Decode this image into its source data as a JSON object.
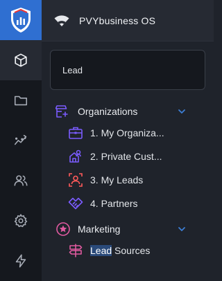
{
  "app": {
    "title": "PVYbusiness OS"
  },
  "search": {
    "value": "Lead",
    "placeholder": ""
  },
  "rail": {
    "items": [
      "cube-icon",
      "folder-icon",
      "trend-icon",
      "users-icon",
      "gear-icon",
      "bolt-icon"
    ],
    "active": "cube-icon"
  },
  "groups": [
    {
      "label": "Organizations",
      "icon": "organizations-icon",
      "expanded": true,
      "items": [
        {
          "label": "1. My Organiza...",
          "icon": "briefcase-icon"
        },
        {
          "label": "2. Private Cust...",
          "icon": "private-customers-icon"
        },
        {
          "label": "3. My Leads",
          "icon": "leads-icon"
        },
        {
          "label": "4. Partners",
          "icon": "handshake-icon"
        }
      ]
    },
    {
      "label": "Marketing",
      "icon": "marketing-icon",
      "expanded": true,
      "items": [
        {
          "label_match": "Lead",
          "label_rest": " Sources",
          "icon": "signpost-icon"
        }
      ]
    }
  ],
  "colors": {
    "brand": "#2f6fd1",
    "rail_bg": "#15181e",
    "panel_bg": "#1f232b",
    "organizations_accent": "#7b5cff",
    "leads_accent": "#ff5a5a",
    "marketing_accent": "#e05aa0",
    "chevron": "#3d7fd6",
    "search_highlight": "#2a4a7a"
  }
}
